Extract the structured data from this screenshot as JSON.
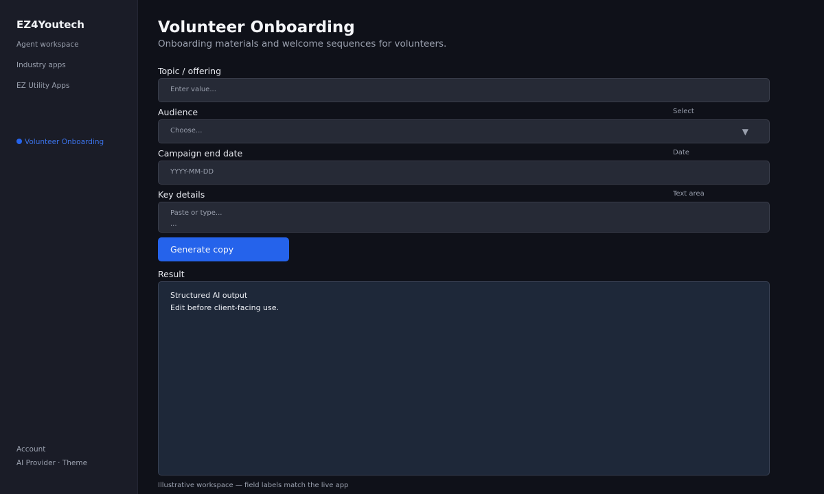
{
  "sidebar": {
    "brand": "EZ4Youtech",
    "nav": [
      {
        "label": "Agent workspace"
      },
      {
        "label": "Industry apps"
      },
      {
        "label": "EZ Utility Apps"
      }
    ],
    "active_item": "Volunteer Onboarding",
    "footer": {
      "account": "Account",
      "provider_theme": "AI Provider · Theme"
    }
  },
  "main": {
    "title": "Volunteer Onboarding",
    "subtitle": "Onboarding materials and welcome sequences for volunteers.",
    "fields": [
      {
        "label": "Topic / offering",
        "type": "",
        "placeholder": "Enter value..."
      },
      {
        "label": "Audience",
        "type": "Select",
        "placeholder": "Choose..."
      },
      {
        "label": "Campaign end date",
        "type": "Date",
        "placeholder": "YYYY-MM-DD"
      },
      {
        "label": "Key details",
        "type": "Text area",
        "placeholder": "Paste or type...",
        "placeholder_line2": "..."
      }
    ],
    "generate_label": "Generate copy",
    "result_label": "Result",
    "result_lines": [
      "Structured AI output",
      "Edit before client-facing use."
    ],
    "footnote": "Illustrative workspace — field labels match the live app"
  },
  "icons": {
    "select_caret": "chevron-down-icon",
    "active_dot": "dot-icon"
  },
  "colors": {
    "accent": "#2563eb",
    "background": "#0f1119",
    "sidebar": "#1a1c27",
    "input": "#262a36",
    "result": "#1e2839"
  }
}
